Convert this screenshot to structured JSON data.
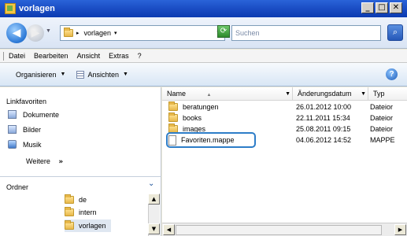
{
  "window": {
    "title": "vorlagen",
    "controls": [
      "_",
      "□",
      "✕"
    ]
  },
  "address": {
    "path": "vorlagen",
    "search_placeholder": "Suchen"
  },
  "menu": [
    "Datei",
    "Bearbeiten",
    "Ansicht",
    "Extras",
    "?"
  ],
  "toolbar": {
    "organize": "Organisieren",
    "views": "Ansichten"
  },
  "nav": {
    "favorites_title": "Linkfavoriten",
    "favorites": [
      "Dokumente",
      "Bilder",
      "Musik"
    ],
    "more": "Weitere",
    "more_glyph": "»",
    "folders_title": "Ordner",
    "tree": [
      "de",
      "intern",
      "vorlagen"
    ]
  },
  "columns": {
    "name": "Name",
    "date": "Änderungsdatum",
    "type": "Typ"
  },
  "files": [
    {
      "name": "beratungen",
      "date": "26.01.2012 10:00",
      "type": "Dateior",
      "kind": "folder"
    },
    {
      "name": "books",
      "date": "22.11.2011 15:34",
      "type": "Dateior",
      "kind": "folder"
    },
    {
      "name": "images",
      "date": "25.08.2011 09:15",
      "type": "Dateior",
      "kind": "folder"
    },
    {
      "name": "Favoriten.mappe",
      "date": "04.06.2012 14:52",
      "type": "MAPPE",
      "kind": "file"
    }
  ]
}
